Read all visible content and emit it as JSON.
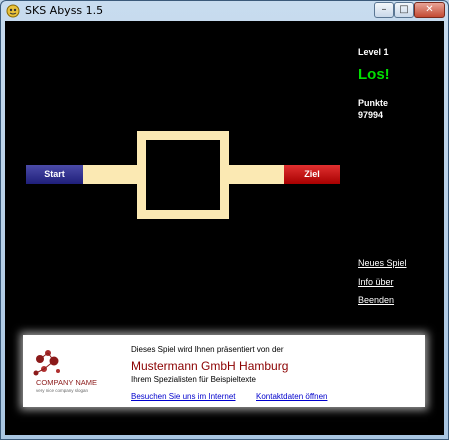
{
  "window": {
    "title": "SKS Abyss 1.5",
    "controls": {
      "minimize": "–",
      "maximize": "□",
      "close": "✕"
    }
  },
  "hud": {
    "level_label": "Level 1",
    "status": "Los!",
    "points_label": "Punkte",
    "points_value": "97994"
  },
  "game": {
    "start_label": "Start",
    "goal_label": "Ziel"
  },
  "menu": {
    "new_game": "Neues Spiel",
    "info": "Info über",
    "quit": "Beenden"
  },
  "banner": {
    "logo_company": "COMPANY NAME",
    "logo_slogan": "very nice company slogan",
    "intro": "Dieses Spiel wird Ihnen präsentiert von der",
    "company": "Mustermann GmbH Hamburg",
    "tagline": "Ihrem Spezialisten für Beispieltexte",
    "link_visit": "Besuchen Sie uns im Internet",
    "link_contact": "Kontaktdaten öffnen"
  },
  "colors": {
    "background": "#000000",
    "path": "#fbe9b3",
    "start": "#2a2a8a",
    "goal": "#cc0000",
    "status": "#00e000",
    "company": "#8b0000"
  }
}
